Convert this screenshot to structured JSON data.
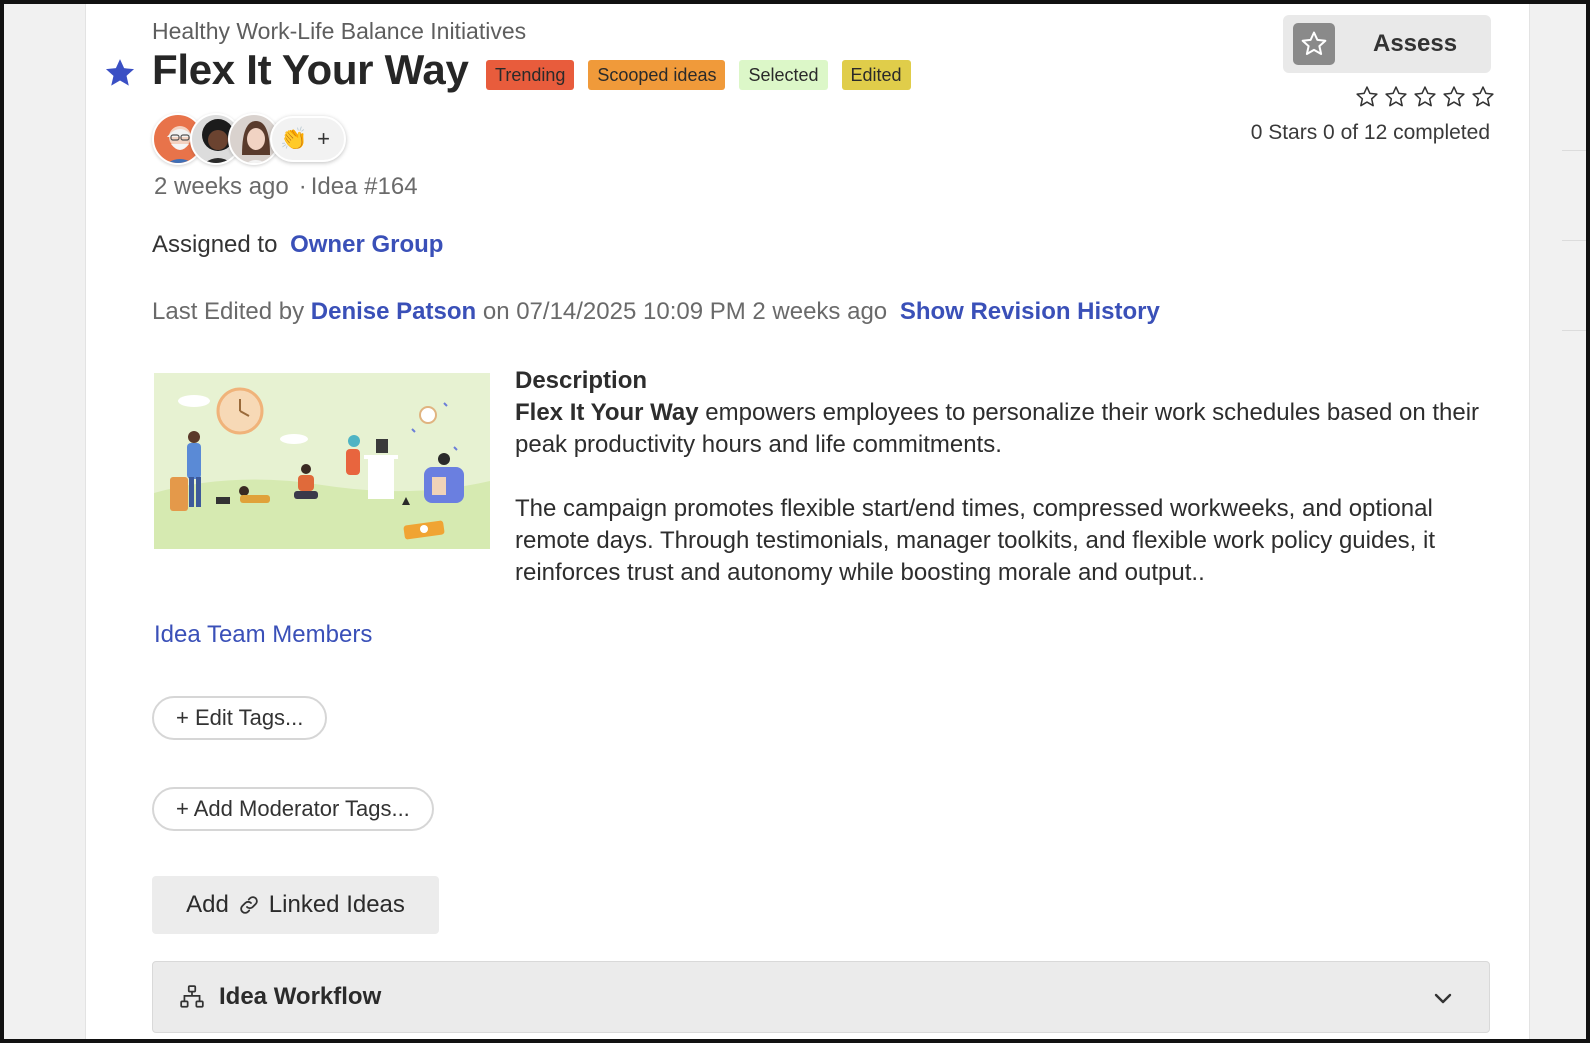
{
  "campaign": "Healthy Work-Life Balance Initiatives",
  "idea": {
    "title": "Flex It Your Way",
    "badges": [
      {
        "label": "Trending",
        "bg": "#e85c3c"
      },
      {
        "label": "Scooped ideas",
        "bg": "#f09a3a"
      },
      {
        "label": "Selected",
        "bg": "#dcf7c8"
      },
      {
        "label": "Edited",
        "bg": "#e0cd4a"
      }
    ],
    "avatars_more": "+",
    "time_ago": "2 weeks ago",
    "dot": "·",
    "idea_number": "Idea #164"
  },
  "assignment": {
    "label": "Assigned to",
    "group": "Owner Group"
  },
  "last_edited": {
    "prefix": "Last Edited by",
    "editor": "Denise Patson",
    "when": "on 07/14/2025 10:09 PM 2 weeks ago",
    "history_link": "Show Revision History"
  },
  "description": {
    "heading": "Description",
    "lead_bold": "Flex It Your Way",
    "lead_rest": " empowers employees to personalize their work schedules based on their peak productivity hours and life commitments.",
    "paragraph2": "The campaign promotes flexible start/end times, compressed workweeks, and optional remote days. Through testimonials, manager toolkits, and flexible work policy guides, it reinforces trust and autonomy while boosting morale and output.."
  },
  "team_link": "Idea Team Members",
  "buttons": {
    "edit_tags": "+ Edit Tags...",
    "moderator_tags": "+ Add Moderator Tags...",
    "linked_add": "Add",
    "linked_ideas": "Linked Ideas"
  },
  "workflow": {
    "label": "Idea Workflow"
  },
  "assess": {
    "label": "Assess",
    "stars_max": 5,
    "stars_filled": 0,
    "summary": "0 Stars 0 of 12 completed"
  },
  "colors": {
    "accent_link": "#3a50b8",
    "favorite_star": "#3a4fc4"
  }
}
